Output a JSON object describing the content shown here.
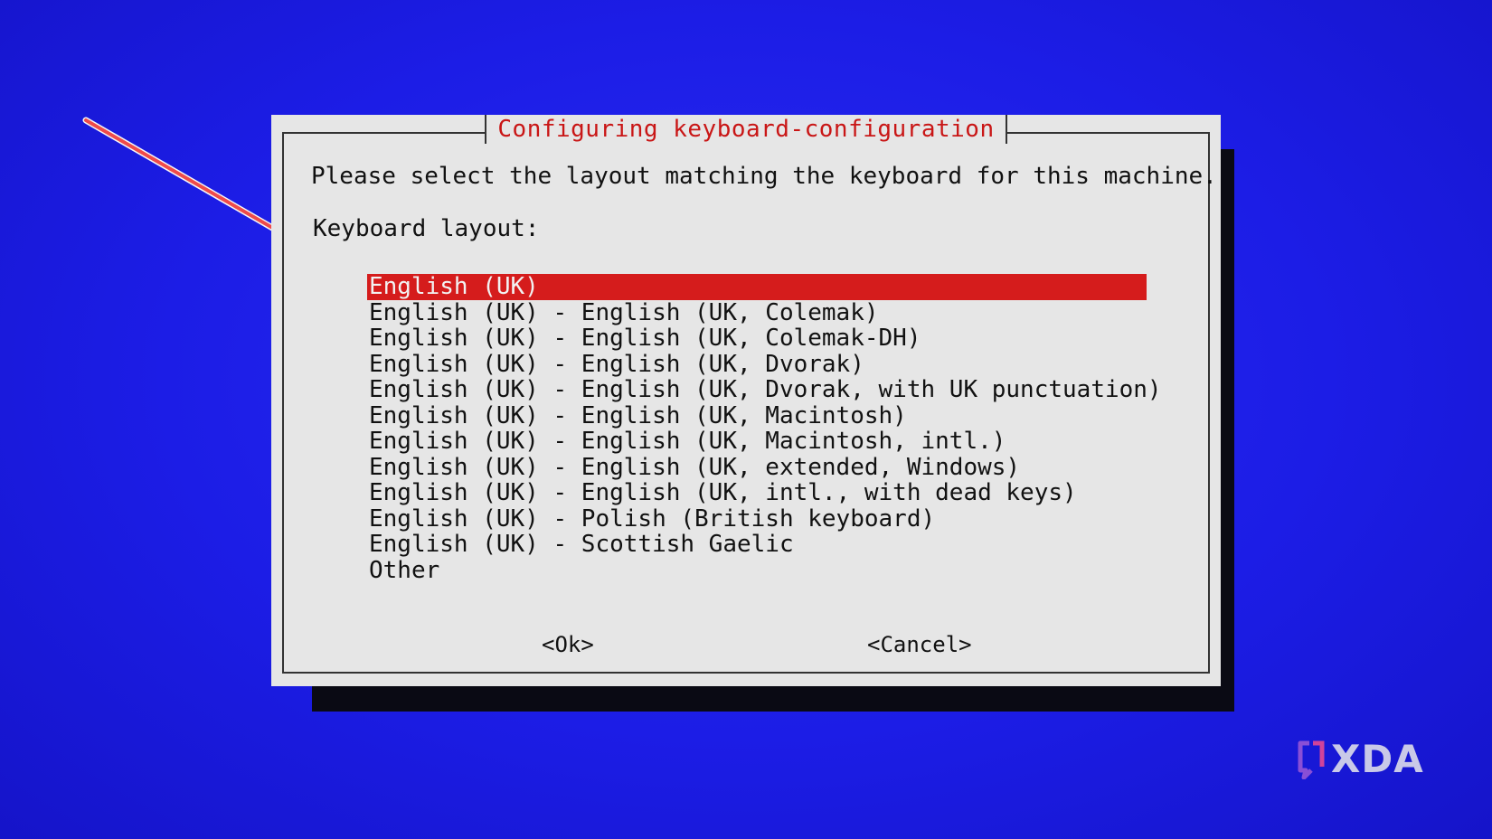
{
  "dialog": {
    "title": "Configuring keyboard-configuration",
    "prompt": "Please select the layout matching the keyboard for this machine.",
    "field_label": "Keyboard layout:",
    "options": [
      "English (UK)",
      "English (UK) - English (UK, Colemak)",
      "English (UK) - English (UK, Colemak-DH)",
      "English (UK) - English (UK, Dvorak)",
      "English (UK) - English (UK, Dvorak, with UK punctuation)",
      "English (UK) - English (UK, Macintosh)",
      "English (UK) - English (UK, Macintosh, intl.)",
      "English (UK) - English (UK, extended, Windows)",
      "English (UK) - English (UK, intl., with dead keys)",
      "English (UK) - Polish (British keyboard)",
      "English (UK) - Scottish Gaelic",
      "Other"
    ],
    "selected_index": 0,
    "ok_label": "<Ok>",
    "cancel_label": "<Cancel>"
  },
  "watermark": {
    "text": "XDA",
    "icon": "xda-bracket-icon"
  },
  "colors": {
    "background": "#1c1de6",
    "dialog": "#e6e6e6",
    "title": "#c91616",
    "selection": "#d51c1c",
    "arrow": "#ef4a4a"
  }
}
